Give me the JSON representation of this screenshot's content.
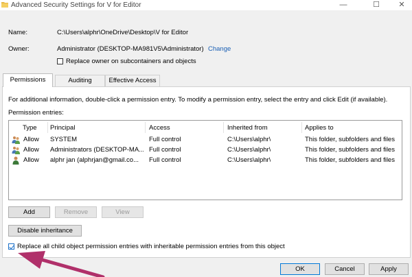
{
  "window": {
    "title": "Advanced Security Settings for V for Editor",
    "minimize": "—",
    "maximize": "☐",
    "close": "✕"
  },
  "header": {
    "name_label": "Name:",
    "name_value": "C:\\Users\\alphr\\OneDrive\\Desktop\\V for Editor",
    "owner_label": "Owner:",
    "owner_value": "Administrator (DESKTOP-MA981V5\\Administrator)",
    "change_link": "Change",
    "replace_owner_label": "Replace owner on subcontainers and objects",
    "replace_owner_checked": false
  },
  "tabs": [
    {
      "label": "Permissions",
      "active": true
    },
    {
      "label": "Auditing",
      "active": false
    },
    {
      "label": "Effective Access",
      "active": false
    }
  ],
  "permissions": {
    "info_text": "For additional information, double-click a permission entry. To modify a permission entry, select the entry and click Edit (if available).",
    "entries_label": "Permission entries:",
    "columns": [
      "Type",
      "Principal",
      "Access",
      "Inherited from",
      "Applies to"
    ],
    "rows": [
      {
        "icon": "group-users-icon",
        "type": "Allow",
        "principal": "SYSTEM",
        "access": "Full control",
        "inherited_from": "C:\\Users\\alphr\\",
        "applies_to": "This folder, subfolders and files"
      },
      {
        "icon": "group-users-icon",
        "type": "Allow",
        "principal": "Administrators (DESKTOP-MA...",
        "access": "Full control",
        "inherited_from": "C:\\Users\\alphr\\",
        "applies_to": "This folder, subfolders and files"
      },
      {
        "icon": "single-user-icon",
        "type": "Allow",
        "principal": "alphr jan (alphrjan@gmail.co...",
        "access": "Full control",
        "inherited_from": "C:\\Users\\alphr\\",
        "applies_to": "This folder, subfolders and files"
      }
    ],
    "add_button": "Add",
    "remove_button": "Remove",
    "view_button": "View",
    "disable_inheritance_button": "Disable inheritance",
    "replace_child_label": "Replace all child object permission entries with inheritable permission entries from this object",
    "replace_child_checked": true
  },
  "footer": {
    "ok": "OK",
    "cancel": "Cancel",
    "apply": "Apply"
  },
  "colors": {
    "link": "#1a5fb4",
    "checkbox_accent": "#1a6fc8",
    "annotation_arrow": "#b0306a"
  }
}
